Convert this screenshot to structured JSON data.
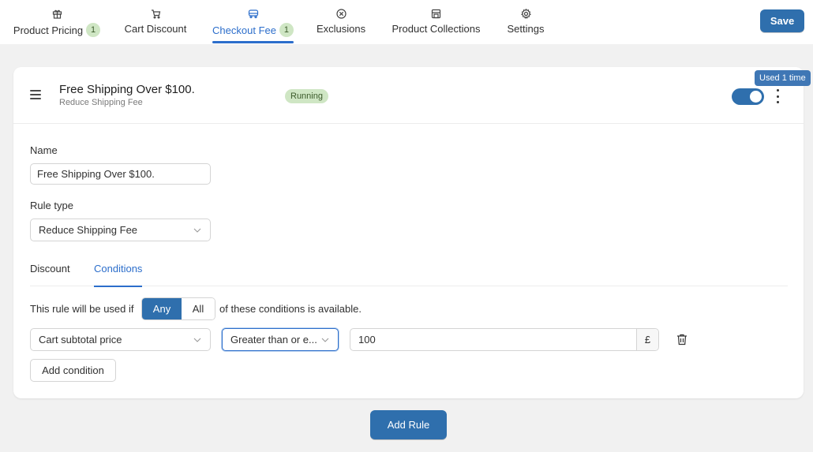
{
  "nav": {
    "tabs": [
      {
        "label": "Product Pricing",
        "count": "1",
        "icon": "gift-icon"
      },
      {
        "label": "Cart Discount",
        "count": "",
        "icon": "cart-icon"
      },
      {
        "label": "Checkout Fee",
        "count": "1",
        "icon": "truck-icon",
        "active": true
      },
      {
        "label": "Exclusions",
        "count": "",
        "icon": "circle-x-icon"
      },
      {
        "label": "Product Collections",
        "count": "",
        "icon": "store-icon"
      },
      {
        "label": "Settings",
        "count": "",
        "icon": "gear-icon"
      }
    ],
    "save_label": "Save"
  },
  "rule": {
    "title": "Free Shipping Over $100.",
    "subtitle": "Reduce Shipping Fee",
    "status": "Running",
    "enabled": true,
    "used_tooltip": "Used 1 time",
    "name_label": "Name",
    "name_value": "Free Shipping Over $100.",
    "rule_type_label": "Rule type",
    "rule_type_value": "Reduce Shipping Fee"
  },
  "subtabs": [
    {
      "label": "Discount"
    },
    {
      "label": "Conditions",
      "active": true
    }
  ],
  "conditions": {
    "prefix": "This rule will be used if",
    "options": [
      "Any",
      "All"
    ],
    "selected": "Any",
    "suffix": "of these conditions is available.",
    "row": {
      "field": "Cart subtotal price",
      "operator": "Greater than or e...",
      "value": "100",
      "currency": "£"
    },
    "add_label": "Add condition"
  },
  "footer": {
    "add_rule_label": "Add Rule"
  },
  "colors": {
    "accent": "#2f6fad",
    "link_active": "#2c6ecb",
    "badge_bg": "#cfe6c4"
  }
}
